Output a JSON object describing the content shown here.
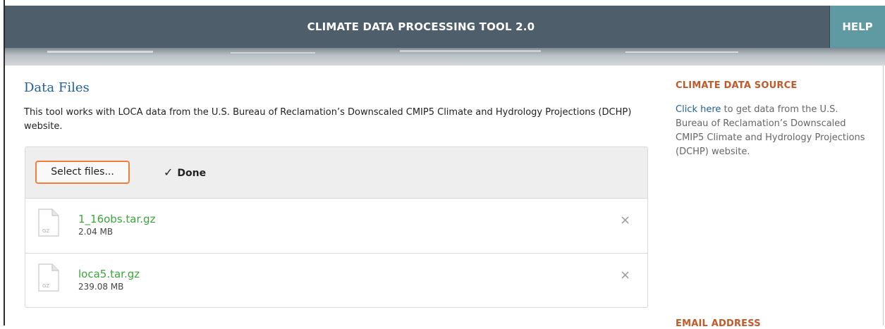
{
  "header": {
    "title": "CLIMATE DATA PROCESSING TOOL 2.0",
    "help_label": "HELP"
  },
  "main": {
    "section_title": "Data Files",
    "description": "This tool works with LOCA data from the U.S. Bureau of Reclamation’s Downscaled CMIP5 Climate and Hydrology Projections (DCHP) website.",
    "select_files_label": "Select files...",
    "done_label": "Done",
    "files": [
      {
        "name": "1_16obs.tar.gz",
        "size": "2.04 MB",
        "icon_label": "GZ",
        "remove_symbol": "×"
      },
      {
        "name": "loca5.tar.gz",
        "size": "239.08 MB",
        "icon_label": "GZ",
        "remove_symbol": "×"
      }
    ]
  },
  "sidebar": {
    "title": "CLIMATE DATA SOURCE",
    "link_text": "Click here",
    "text": " to get data from the U.S. Bureau of Reclamation’s Downscaled CMIP5 Climate and Hydrology Projections (DCHP) website.",
    "bottom_heading": "EMAIL ADDRESS"
  },
  "colors": {
    "header_bg": "#4e5e6a",
    "help_bg": "#5f99a1",
    "section_title": "#1f5f99",
    "accent_orange": "#f07f3c",
    "file_name_green": "#3aa63a",
    "side_title": "#c15a2b",
    "link": "#1f5f99"
  },
  "icons": {
    "done": "checkmark-icon",
    "file": "file-icon",
    "remove": "close-icon"
  }
}
